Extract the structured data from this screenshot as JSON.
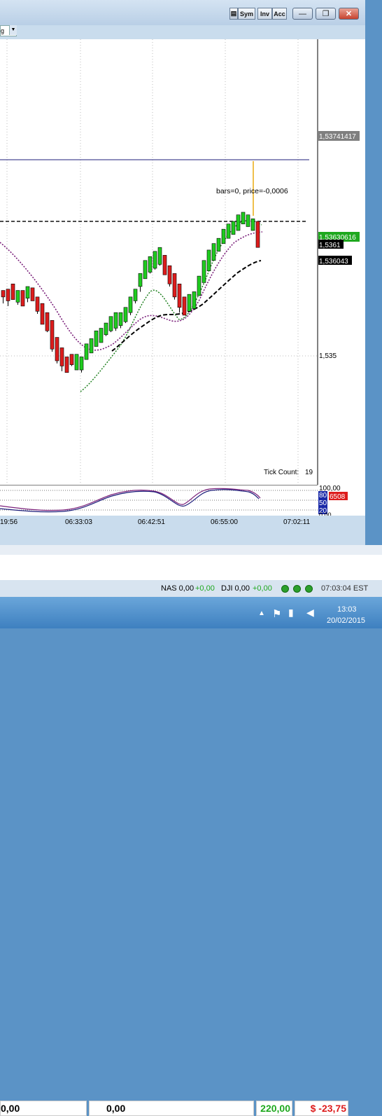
{
  "window": {
    "buttons": {
      "sym": "Sym",
      "inv": "Inv",
      "acc": "Acc"
    },
    "minimize_symbol": "—",
    "restore_symbol": "❐",
    "close_symbol": "✕",
    "dropdown_text": "g"
  },
  "chart": {
    "price_labels": [
      {
        "text": "1,53741417",
        "style": "gray"
      },
      {
        "text": "1,53630616",
        "style": "green"
      },
      {
        "text": "1,5361",
        "style": "black"
      },
      {
        "text": "1,536043",
        "style": "black"
      },
      {
        "text": "1,535",
        "style": "plain"
      }
    ],
    "annotation": "bars=0, price=-0,0006",
    "tick_count_label": "Tick Count:",
    "tick_count_value": "19",
    "time_labels": [
      "19:56",
      "06:33:03",
      "06:42:51",
      "06:55:00",
      "07:02:11"
    ]
  },
  "indicator": {
    "scale_labels": [
      "100,00",
      "0,00"
    ],
    "level_labels": [
      "80",
      "50",
      "20"
    ],
    "value_label": "6508"
  },
  "account": {
    "values": [
      "0,00",
      "0,00",
      "220,00",
      "$ -23,75"
    ]
  },
  "statusbar": {
    "nas": "NAS 0,00",
    "nas_change": "+0,00",
    "dji": "DJI 0,00",
    "dji_change": "+0,00",
    "time": "07:03:04 EST"
  },
  "taskbar": {
    "time": "13:03",
    "date": "20/02/2015"
  },
  "colors": {
    "up_candle": "#1fcc1f",
    "down_candle": "#dd1c1c",
    "accent_green": "#1ea81e",
    "accent_red": "#dd1c1c",
    "guide_line": "#1c1c7a"
  },
  "chart_data": {
    "type": "candlestick",
    "series_y": [
      1.5356,
      1.536,
      1.537,
      1.538
    ],
    "candles": [
      [
        1.53565,
        1.53567,
        1.53562,
        1.53557,
        "d"
      ],
      [
        1.53564,
        1.53568,
        1.53559,
        1.53555,
        "d"
      ],
      [
        1.53566,
        1.53572,
        1.5356,
        1.53563,
        "d"
      ],
      [
        1.53563,
        1.53567,
        1.53558,
        1.53556,
        "u"
      ],
      [
        1.53563,
        1.53567,
        1.53555,
        1.53556,
        "d"
      ],
      [
        1.53565,
        1.5357,
        1.53561,
        1.53558,
        "u"
      ],
      [
        1.53566,
        1.53569,
        1.53559,
        1.53562,
        "d"
      ],
      [
        1.53559,
        1.53562,
        1.53551,
        1.53549,
        "d"
      ],
      [
        1.53553,
        1.53557,
        1.53541,
        1.53543,
        "d"
      ],
      [
        1.53548,
        1.5355,
        1.53536,
        1.53535,
        "d"
      ],
      [
        1.53542,
        1.53544,
        1.53522,
        1.5352,
        "d"
      ],
      [
        1.53528,
        1.53531,
        1.53513,
        1.53511,
        "d"
      ],
      [
        1.53521,
        1.53523,
        1.53509,
        1.53505,
        "d"
      ],
      [
        1.53512,
        1.53516,
        1.53504,
        1.53505,
        "d"
      ],
      [
        1.53514,
        1.53518,
        1.5351,
        1.53509,
        "d"
      ],
      [
        1.53515,
        1.53518,
        1.53506,
        1.53511,
        "u"
      ],
      [
        1.53512,
        1.53516,
        1.53506,
        1.53504,
        "u"
      ],
      [
        1.53515,
        1.53526,
        1.53514,
        1.53515,
        "u"
      ],
      [
        1.53522,
        1.5353,
        1.53519,
        1.5352,
        "u"
      ],
      [
        1.53527,
        1.53536,
        1.53524,
        1.53525,
        "u"
      ],
      [
        1.53531,
        1.53538,
        1.53527,
        1.53527,
        "u"
      ],
      [
        1.53536,
        1.53542,
        1.53533,
        1.53532,
        "u"
      ],
      [
        1.53538,
        1.53547,
        1.53536,
        1.53535,
        "u"
      ],
      [
        1.5354,
        1.5355,
        1.53538,
        1.53536,
        "u"
      ],
      [
        1.53543,
        1.5355,
        1.5354,
        1.53538,
        "u"
      ],
      [
        1.53546,
        1.53554,
        1.53543,
        1.53542,
        "u"
      ],
      [
        1.53554,
        1.53562,
        1.5355,
        1.53548,
        "u"
      ],
      [
        1.53562,
        1.53568,
        1.53559,
        1.53557,
        "u"
      ],
      [
        1.53575,
        1.5358,
        1.5357,
        1.53566,
        "u"
      ],
      [
        1.5358,
        1.5359,
        1.53576,
        1.53576,
        "u"
      ],
      [
        1.53585,
        1.53593,
        1.53581,
        1.5358,
        "u"
      ],
      [
        1.5359,
        1.53597,
        1.53584,
        1.53583,
        "u"
      ],
      [
        1.53592,
        1.536,
        1.53587,
        1.53586,
        "u"
      ],
      [
        1.53589,
        1.53594,
        1.53579,
        1.53582,
        "d"
      ],
      [
        1.53582,
        1.53586,
        1.53572,
        1.5357,
        "d"
      ],
      [
        1.53575,
        1.5358,
        1.53562,
        1.5356,
        "d"
      ],
      [
        1.53567,
        1.53572,
        1.53554,
        1.5355,
        "d"
      ],
      [
        1.53559,
        1.53562,
        1.53548,
        1.5355,
        "d"
      ],
      [
        1.53556,
        1.53564,
        1.53551,
        1.53552,
        "u"
      ],
      [
        1.53559,
        1.53566,
        1.53553,
        1.53556,
        "u"
      ],
      [
        1.53567,
        1.53578,
        1.53563,
        1.53564,
        "u"
      ],
      [
        1.5358,
        1.5359,
        1.53573,
        1.53575,
        "u"
      ],
      [
        1.5359,
        1.53598,
        1.53582,
        1.53585,
        "u"
      ],
      [
        1.53597,
        1.53603,
        1.5359,
        1.5359,
        "u"
      ],
      [
        1.53603,
        1.53607,
        1.53597,
        1.53598,
        "u"
      ],
      [
        1.53608,
        1.53614,
        1.53603,
        1.53603,
        "u"
      ],
      [
        1.53612,
        1.53618,
        1.53607,
        1.53608,
        "u"
      ],
      [
        1.53616,
        1.5362,
        1.5361,
        1.53611,
        "u"
      ],
      [
        1.5362,
        1.53625,
        1.53613,
        1.53615,
        "u"
      ],
      [
        1.53622,
        1.53627,
        1.53618,
        1.53618,
        "u"
      ],
      [
        1.5362,
        1.53625,
        1.53616,
        1.53616,
        "u"
      ],
      [
        1.53618,
        1.53622,
        1.53613,
        1.53613,
        "u"
      ],
      [
        1.53617,
        1.5362,
        1.536,
        1.53604,
        "d"
      ]
    ],
    "reference_lines": {
      "dashed_level": 1.5362,
      "solid_level": 1.53741417
    },
    "ylim": [
      1.5349,
      1.5376
    ]
  }
}
